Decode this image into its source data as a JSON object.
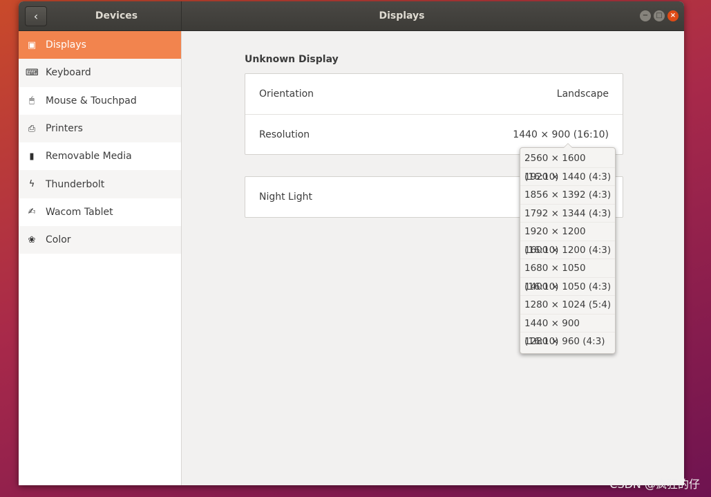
{
  "header": {
    "back_icon": "‹",
    "sidebar_title": "Devices",
    "title": "Displays",
    "window_controls": [
      "−",
      "□",
      "×"
    ]
  },
  "sidebar": {
    "items": [
      {
        "label": "Displays",
        "icon": "display-icon",
        "glyph": "▣",
        "active": true
      },
      {
        "label": "Keyboard",
        "icon": "keyboard-icon",
        "glyph": "⌨",
        "active": false
      },
      {
        "label": "Mouse & Touchpad",
        "icon": "mouse-icon",
        "glyph": "🖱",
        "active": false
      },
      {
        "label": "Printers",
        "icon": "printer-icon",
        "glyph": "⎙",
        "active": false
      },
      {
        "label": "Removable Media",
        "icon": "usb-icon",
        "glyph": "▮",
        "active": false
      },
      {
        "label": "Thunderbolt",
        "icon": "thunderbolt-icon",
        "glyph": "ϟ",
        "active": false
      },
      {
        "label": "Wacom Tablet",
        "icon": "tablet-icon",
        "glyph": "✍",
        "active": false
      },
      {
        "label": "Color",
        "icon": "color-icon",
        "glyph": "❀",
        "active": false
      }
    ]
  },
  "main": {
    "section_title": "Unknown Display",
    "orientation": {
      "label": "Orientation",
      "value": "Landscape"
    },
    "resolution": {
      "label": "Resolution",
      "value": "1440 × 900 (16:10)"
    },
    "night_light": {
      "label": "Night Light"
    }
  },
  "resolution_options": [
    "2560 × 1600 (16:10)",
    "1920 × 1440 (4:3)",
    "1856 × 1392 (4:3)",
    "1792 × 1344 (4:3)",
    "1920 × 1200 (16:10)",
    "1600 × 1200 (4:3)",
    "1680 × 1050 (16:10)",
    "1400 × 1050 (4:3)",
    "1280 × 1024 (5:4)",
    "1440 × 900 (16:10)",
    "1280 × 960 (4:3)"
  ],
  "watermark": "CSDN @疯狂的仔",
  "colors": {
    "accent": "#f2844e",
    "headerbar": "#3c3b37",
    "close_button": "#df4b16"
  }
}
